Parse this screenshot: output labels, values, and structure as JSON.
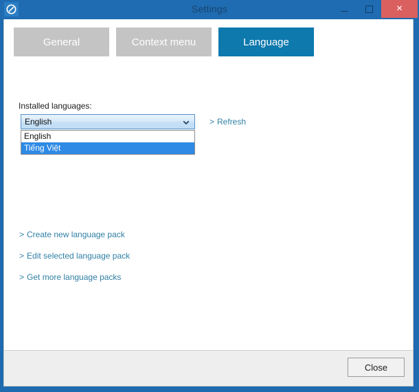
{
  "window": {
    "title": "Settings",
    "icon": "app-logo-icon",
    "frame_color": "#1f6cb2",
    "controls": {
      "minimize": "–",
      "maximize": "□",
      "close": "×",
      "close_color": "#d9605f"
    }
  },
  "tabs": [
    {
      "label": "General",
      "active": false
    },
    {
      "label": "Context menu",
      "active": false
    },
    {
      "label": "Language",
      "active": true
    }
  ],
  "tab_colors": {
    "inactive_bg": "#c4c4c4",
    "active_bg": "#0d79ad",
    "text": "#ffffff"
  },
  "language_panel": {
    "installed_label": "Installed languages:",
    "combo": {
      "value": "English",
      "expanded": true,
      "arrow_icon": "chevron-down-icon",
      "options": [
        {
          "label": "English",
          "selected": false
        },
        {
          "label": "Tiếng Việt",
          "selected": true
        }
      ],
      "highlight_color": "#2e8ae5"
    },
    "links": [
      {
        "marker": ">",
        "label": "Refresh"
      },
      {
        "marker": ">",
        "label": "Create new language pack"
      },
      {
        "marker": ">",
        "label": "Edit selected language pack"
      },
      {
        "marker": ">",
        "label": "Get more language packs"
      }
    ],
    "link_color": "#2f7fa5"
  },
  "footer": {
    "close_label": "Close"
  }
}
